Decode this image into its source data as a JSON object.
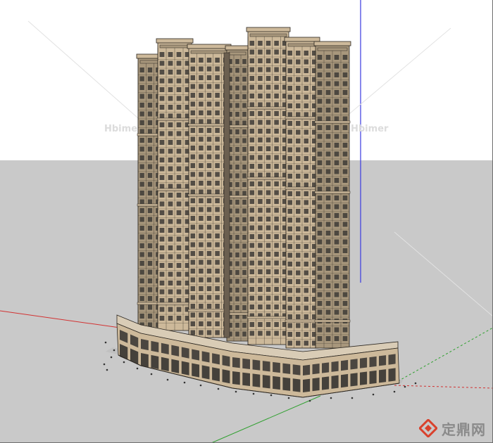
{
  "viewport": {
    "sky_color": "#ffffff",
    "ground_color": "#c9c9c9",
    "axes": {
      "red": "#d23232",
      "green": "#2fa02f",
      "blue": "#3a3adf"
    }
  },
  "model": {
    "facade_color": "#cdb99a",
    "facade_shadow": "#a8977c",
    "window_color": "#3d3a36",
    "podium_color": "#d9ccb6",
    "line_color": "#2b2620"
  },
  "watermarks": [
    {
      "text": "Hbimer"
    },
    {
      "text": "Hbimer"
    }
  ],
  "brand": {
    "logo_icon": "diamond-logo-icon",
    "name": "定鼎网",
    "accent": "#d9412c"
  }
}
